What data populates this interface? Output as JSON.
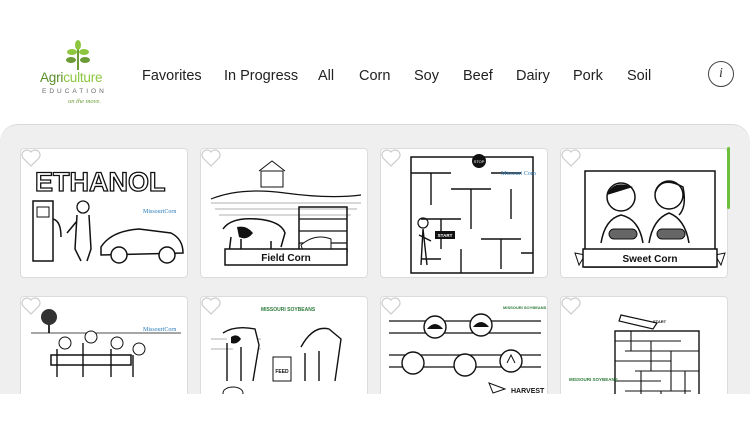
{
  "logo": {
    "brand_prefix": "Agri",
    "brand_suffix": "culture",
    "sub": "EDUCATION",
    "tagline": "on the move."
  },
  "nav": [
    "Favorites",
    "In Progress",
    "All",
    "Corn",
    "Soy",
    "Beef",
    "Dairy",
    "Pork",
    "Soil"
  ],
  "info_label": "i",
  "cards": [
    {
      "title": "ETHANOL",
      "caption": "MissouriCorn"
    },
    {
      "title": "Field Corn"
    },
    {
      "title": "START",
      "caption": "Missouri Corn",
      "extra": "STOP"
    },
    {
      "title": "Sweet Corn"
    },
    {
      "caption": "MissouriCorn"
    },
    {
      "caption": "MISSOURI SOYBEANS",
      "extra": "FEED"
    },
    {
      "caption": "MISSOURI SOYBEANS",
      "extra": "HARVEST"
    },
    {
      "caption": "MISSOURI SOYBEANS",
      "extra": "START"
    }
  ],
  "colors": {
    "accent_green": "#6cbf3a",
    "logo_green": "#8cc63f",
    "panel_bg": "#efefef"
  }
}
